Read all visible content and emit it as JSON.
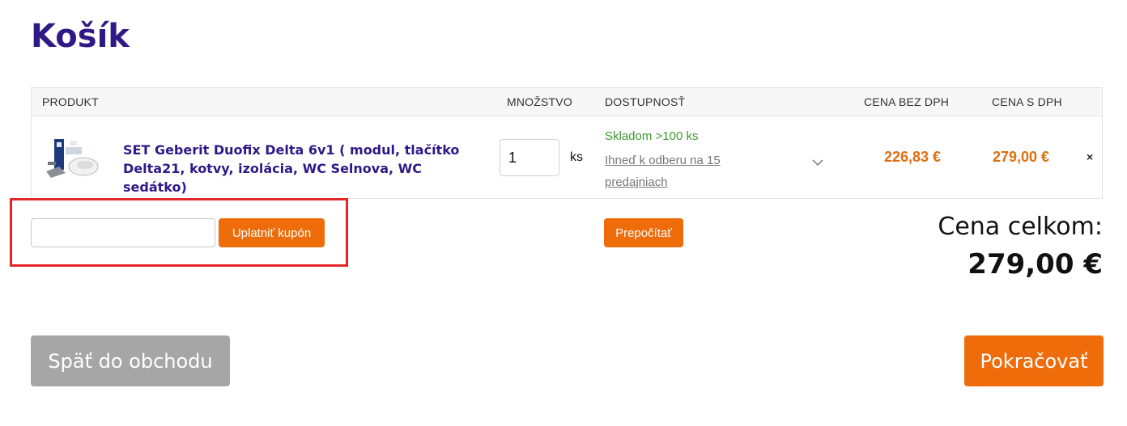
{
  "page": {
    "title": "Košík"
  },
  "table": {
    "headers": {
      "product": "PRODUKT",
      "quantity": "MNOŽSTVO",
      "availability": "DOSTUPNOSŤ",
      "price_net": "CENA BEZ DPH",
      "price_gross": "CENA S DPH"
    },
    "item": {
      "name": "SET Geberit Duofix Delta 6v1 ( modul, tlačítko Delta21, kotvy, izolácia, WC Selnova, WC sedátko)",
      "quantity": "1",
      "unit": "ks",
      "stock": "Skladom >100 ks",
      "pickup": "Ihneď k odberu na 15 predajniach",
      "price_net": "226,83 €",
      "price_gross": "279,00 €",
      "remove": "×"
    }
  },
  "coupon": {
    "placeholder": "",
    "button": "Uplatniť kupón"
  },
  "recalculate": {
    "button": "Prepočítať"
  },
  "total": {
    "label": "Cena celkom:",
    "value": "279,00 €"
  },
  "actions": {
    "back": "Späť do obchodu",
    "continue": "Pokračovať"
  },
  "colors": {
    "title": "#2e1a87",
    "accent": "#ee6c09",
    "price": "#e06e0c",
    "stock": "#3c9a2d",
    "highlight": "#e3262a",
    "back_button": "#a6a6a6"
  }
}
